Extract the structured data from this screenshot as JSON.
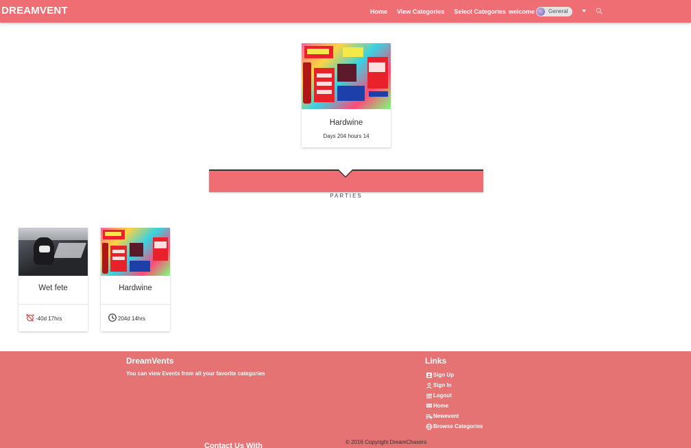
{
  "navbar": {
    "brand": "DREAMVENT",
    "links": [
      "Home",
      "View Categories",
      "Select Categories"
    ],
    "welcome": "welcome",
    "user_chip": "General",
    "colors": {
      "background": "#ee6e73",
      "text": "#ffffff"
    },
    "icons": [
      "caret-down-icon",
      "search-icon"
    ]
  },
  "featured": {
    "title": "Hardwine",
    "countdown": "Days 204 hours 14"
  },
  "section": {
    "label": "PARTIES"
  },
  "events": [
    {
      "title": "Wet fete",
      "time": "-40d 17hrs",
      "icon": "alarm-off-icon",
      "icon_color": "#e53935"
    },
    {
      "title": "Hardwine",
      "time": "204d 14hrs",
      "icon": "clock-icon",
      "icon_color": "#333333"
    }
  ],
  "footer": {
    "brand_title": "DreamVents",
    "brand_desc": "You can view Events from all your favorite categories",
    "links_title": "Links",
    "links": [
      {
        "label": "Sign Up",
        "icon": "account-box-icon"
      },
      {
        "label": "Sign In",
        "icon": "person-icon"
      },
      {
        "label": "Logout",
        "icon": "logout-icon"
      },
      {
        "label": "Home",
        "icon": "grid-icon"
      },
      {
        "label": "Newevent",
        "icon": "playlist-add-icon"
      },
      {
        "label": "Browse Categories",
        "icon": "globe-icon"
      }
    ],
    "copyright": "© 2016 Copyright DreamChasers",
    "contact": "Contact Us With",
    "colors": {
      "background": "#e57373"
    }
  }
}
